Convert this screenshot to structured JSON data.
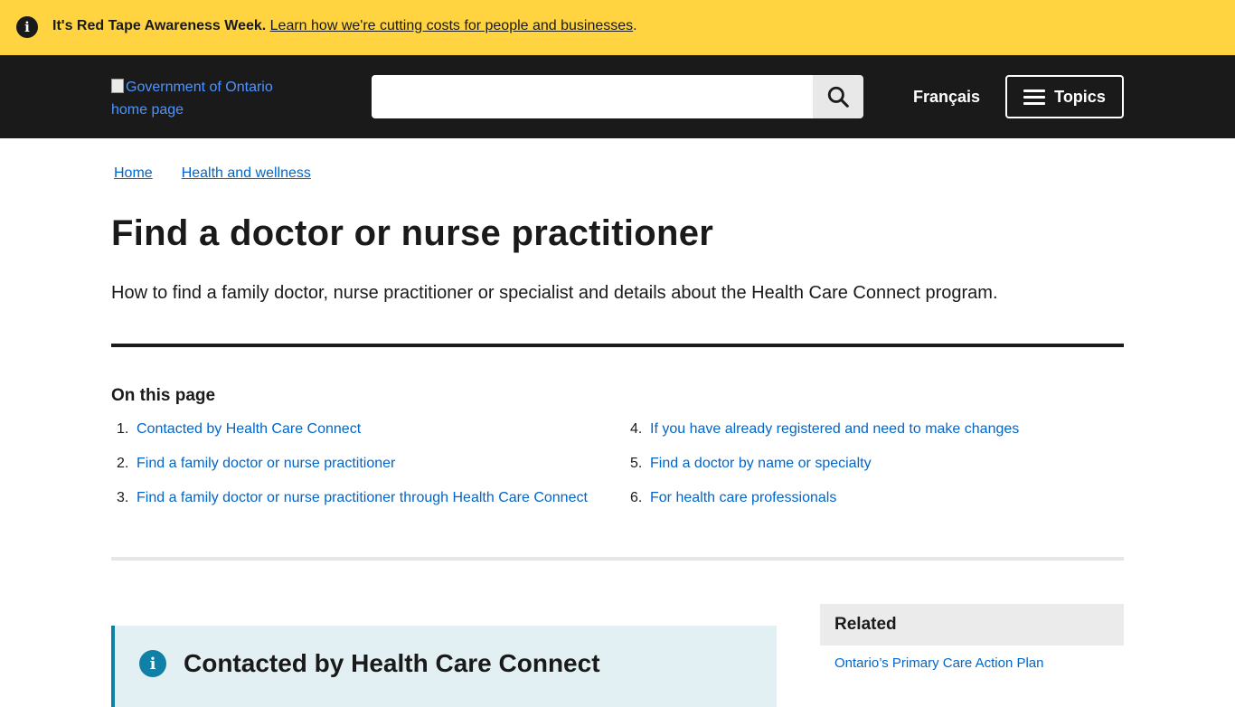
{
  "alert": {
    "icon": "info-icon",
    "bold_text": "It's Red Tape Awareness Week.",
    "link_text": "Learn how we're cutting costs for people and businesses",
    "suffix": "."
  },
  "header": {
    "logo_alt": "Government of Ontario home page",
    "search_placeholder": "",
    "search_icon": "search-icon",
    "language_link": "Français",
    "topics_label": "Topics"
  },
  "breadcrumbs": [
    "Home",
    "Health and wellness"
  ],
  "page": {
    "title": "Find a doctor or nurse practitioner",
    "lead": "How to find a family doctor, nurse practitioner or specialist and details about the Health Care Connect program."
  },
  "toc": {
    "heading": "On this page",
    "items": [
      {
        "num": "1.",
        "label": "Contacted by Health Care Connect"
      },
      {
        "num": "2.",
        "label": "Find a family doctor or nurse practitioner"
      },
      {
        "num": "3.",
        "label": "Find a family doctor or nurse practitioner through Health Care Connect"
      },
      {
        "num": "4.",
        "label": "If you have already registered and need to make changes"
      },
      {
        "num": "5.",
        "label": "Find a doctor by name or specialty"
      },
      {
        "num": "6.",
        "label": "For health care professionals"
      }
    ]
  },
  "callout": {
    "icon": "info-icon",
    "title": "Contacted by Health Care Connect"
  },
  "related": {
    "title": "Related",
    "links": [
      "Ontario’s Primary Care Action Plan"
    ]
  },
  "colors": {
    "alert_bg": "#ffd440",
    "header_bg": "#1a1a1a",
    "link": "#0066cc",
    "callout_bg": "#e2f0f4",
    "callout_accent": "#1080a6"
  }
}
